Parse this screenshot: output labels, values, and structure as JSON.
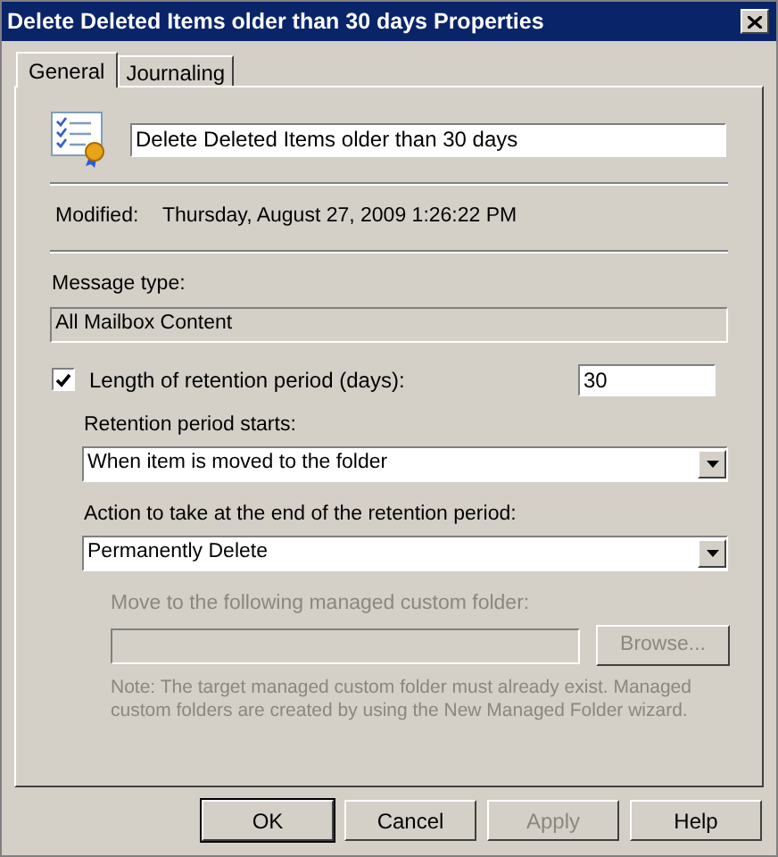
{
  "window": {
    "title": "Delete Deleted Items older than 30 days Properties"
  },
  "tabs": [
    {
      "label": "General",
      "selected": true
    },
    {
      "label": "Journaling",
      "selected": false
    }
  ],
  "name_field": {
    "value": "Delete Deleted Items older than 30 days"
  },
  "modified": {
    "label": "Modified:",
    "value": "Thursday, August 27, 2009 1:26:22 PM"
  },
  "message_type": {
    "label": "Message type:",
    "value": "All Mailbox Content"
  },
  "retention": {
    "label": "Length of retention period (days):",
    "checked": true,
    "value": "30"
  },
  "retention_start": {
    "label": "Retention period starts:",
    "value": "When item is moved to the folder"
  },
  "action": {
    "label": "Action to take at the end of the retention period:",
    "value": "Permanently Delete"
  },
  "move_folder": {
    "label": "Move to the following managed custom folder:",
    "disabled": true,
    "button": "Browse..."
  },
  "note": "Note: The target managed custom folder must already exist. Managed custom folders are created by using the New Managed Folder wizard.",
  "buttons": [
    {
      "label": "OK",
      "default": true,
      "disabled": false
    },
    {
      "label": "Cancel",
      "default": false,
      "disabled": false
    },
    {
      "label": "Apply",
      "default": false,
      "disabled": true
    },
    {
      "label": "Help",
      "default": false,
      "disabled": false
    }
  ]
}
